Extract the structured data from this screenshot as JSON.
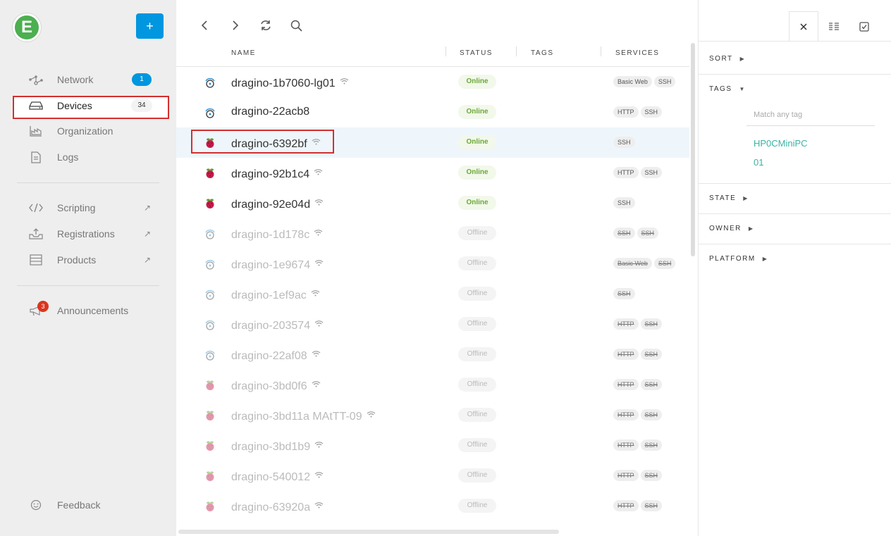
{
  "app": {
    "logo_letter": "E",
    "add_label": "+"
  },
  "sidebar": {
    "items": [
      {
        "label": "Network",
        "badge": "1"
      },
      {
        "label": "Devices",
        "badge": "34"
      },
      {
        "label": "Organization"
      },
      {
        "label": "Logs"
      },
      {
        "label": "Scripting",
        "external": "↗"
      },
      {
        "label": "Registrations",
        "external": "↗"
      },
      {
        "label": "Products",
        "external": "↗"
      },
      {
        "label": "Announcements",
        "badge": "3"
      },
      {
        "label": "Feedback"
      }
    ]
  },
  "table": {
    "columns": {
      "name": "NAME",
      "status": "STATUS",
      "tags": "TAGS",
      "services": "SERVICES"
    },
    "rows": [
      {
        "name": "dragino-1b7060-lg01",
        "icon": "gateway-icon",
        "wifi": true,
        "status": "Online",
        "services": [
          "Basic Web",
          "SSH"
        ]
      },
      {
        "name": "dragino-22acb8",
        "icon": "gateway-icon",
        "wifi": false,
        "status": "Online",
        "services": [
          "HTTP",
          "SSH"
        ]
      },
      {
        "name": "dragino-6392bf",
        "icon": "raspberry-icon",
        "wifi": true,
        "status": "Online",
        "services": [
          "SSH"
        ]
      },
      {
        "name": "dragino-92b1c4",
        "icon": "raspberry-icon",
        "wifi": true,
        "status": "Online",
        "services": [
          "HTTP",
          "SSH"
        ]
      },
      {
        "name": "dragino-92e04d",
        "icon": "raspberry-icon",
        "wifi": true,
        "status": "Online",
        "services": [
          "SSH"
        ]
      },
      {
        "name": "dragino-1d178c",
        "icon": "gateway-icon",
        "wifi": true,
        "status": "Offline",
        "services": [
          "SSH",
          "SSH"
        ]
      },
      {
        "name": "dragino-1e9674",
        "icon": "gateway-icon",
        "wifi": true,
        "status": "Offline",
        "services": [
          "Basic Web",
          "SSH"
        ]
      },
      {
        "name": "dragino-1ef9ac",
        "icon": "gateway-icon",
        "wifi": true,
        "status": "Offline",
        "services": [
          "SSH"
        ]
      },
      {
        "name": "dragino-203574",
        "icon": "gateway-icon",
        "wifi": true,
        "status": "Offline",
        "services": [
          "HTTP",
          "SSH"
        ]
      },
      {
        "name": "dragino-22af08",
        "icon": "gateway-icon",
        "wifi": true,
        "status": "Offline",
        "services": [
          "HTTP",
          "SSH"
        ]
      },
      {
        "name": "dragino-3bd0f6",
        "icon": "raspberry-icon",
        "wifi": true,
        "status": "Offline",
        "services": [
          "HTTP",
          "SSH"
        ]
      },
      {
        "name": "dragino-3bd11a MAtTT-09",
        "icon": "raspberry-icon",
        "wifi": true,
        "status": "Offline",
        "services": [
          "HTTP",
          "SSH"
        ]
      },
      {
        "name": "dragino-3bd1b9",
        "icon": "raspberry-icon",
        "wifi": true,
        "status": "Offline",
        "services": [
          "HTTP",
          "SSH"
        ]
      },
      {
        "name": "dragino-540012",
        "icon": "raspberry-icon",
        "wifi": true,
        "status": "Offline",
        "services": [
          "HTTP",
          "SSH"
        ]
      },
      {
        "name": "dragino-63920a",
        "icon": "raspberry-icon",
        "wifi": true,
        "status": "Offline",
        "services": [
          "HTTP",
          "SSH"
        ]
      }
    ]
  },
  "filters": {
    "sort": "SORT",
    "tags": "TAGS",
    "tag_placeholder": "Match any tag",
    "tag_option_line1": "HP0CMiniPC",
    "tag_option_line2": "01",
    "state": "STATE",
    "owner": "OWNER",
    "platform": "PLATFORM"
  },
  "colors": {
    "accent": "#0096e0",
    "online": "#6aa83a",
    "highlight": "#d32f2f",
    "tag_link": "#3ab3a3"
  }
}
